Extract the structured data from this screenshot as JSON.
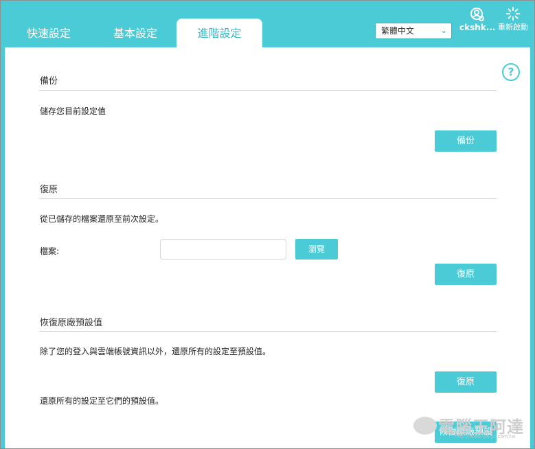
{
  "tabs": {
    "quick": "快速設定",
    "basic": "基本設定",
    "advanced": "進階設定"
  },
  "language": {
    "selected": "繁體中文"
  },
  "account": {
    "name": "ckshk..."
  },
  "reboot": {
    "label": "重新啟動"
  },
  "colors": {
    "accent": "#4acbd6",
    "divider": "#cfcfcf"
  },
  "backup": {
    "title": "備份",
    "desc": "儲存您目前設定值",
    "button": "備份"
  },
  "restore": {
    "title": "復原",
    "desc": "從已儲存的檔案還原至前次設定。",
    "file_label": "檔案:",
    "file_value": "",
    "browse": "瀏覽",
    "button": "復原"
  },
  "factory": {
    "title": "恢復原廠預設值",
    "desc": "除了您的登入與雲端帳號資訊以外，還原所有的設定至預設值。",
    "button": "復原",
    "desc2": "還原所有的設定至它們的預設值。",
    "button2": "恢復原廠預設值"
  },
  "watermark": {
    "text": "電腦王阿達",
    "url": "http://www.kocpc.com.tw"
  }
}
